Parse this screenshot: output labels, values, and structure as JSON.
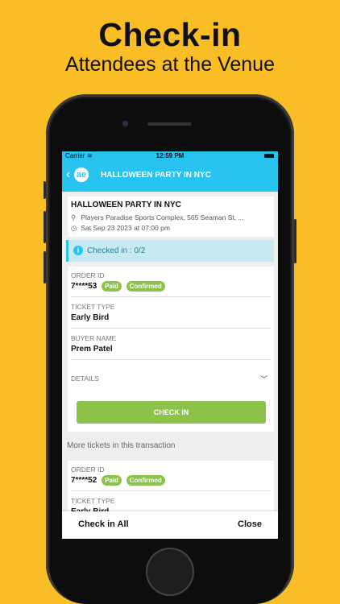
{
  "promo": {
    "title": "Check-in",
    "subtitle": "Attendees at the Venue"
  },
  "status_bar": {
    "carrier": "Carrier",
    "time": "12:59 PM"
  },
  "app_bar": {
    "title": "HALLOWEEN PARTY IN NYC",
    "logo_text": "ae"
  },
  "event": {
    "name": "HALLOWEEN PARTY IN NYC",
    "venue": "Players Paradise Sports Complex, 565 Seaman St, ...",
    "datetime": "Sat Sep 23 2023 at 07:00 pm"
  },
  "checked_in": {
    "text": "Checked in : 0/2"
  },
  "ticket1": {
    "order_id_label": "ORDER ID",
    "order_id": "7****53",
    "badge_paid": "Paid",
    "badge_confirmed": "Confirmed",
    "ticket_type_label": "TICKET TYPE",
    "ticket_type": "Early Bird",
    "buyer_name_label": "BUYER NAME",
    "buyer_name": "Prem Patel",
    "details_label": "DETAILS",
    "checkin_button": "CHECK IN"
  },
  "more_tickets_label": "More tickets in this transaction",
  "ticket2": {
    "order_id_label": "ORDER ID",
    "order_id": "7****52",
    "badge_paid": "Paid",
    "badge_confirmed": "Confirmed",
    "ticket_type_label": "TICKET TYPE",
    "ticket_type": "Early Bird"
  },
  "bottom_bar": {
    "check_in_all": "Check in All",
    "close": "Close"
  },
  "colors": {
    "background": "#F9BD26",
    "accent": "#29C3F0",
    "green": "#8BC34A"
  },
  "icons": [
    "back-chevron-icon",
    "logo-icon",
    "location-pin-icon",
    "clock-icon",
    "info-icon",
    "chevron-down-icon",
    "wifi-icon",
    "battery-icon"
  ]
}
